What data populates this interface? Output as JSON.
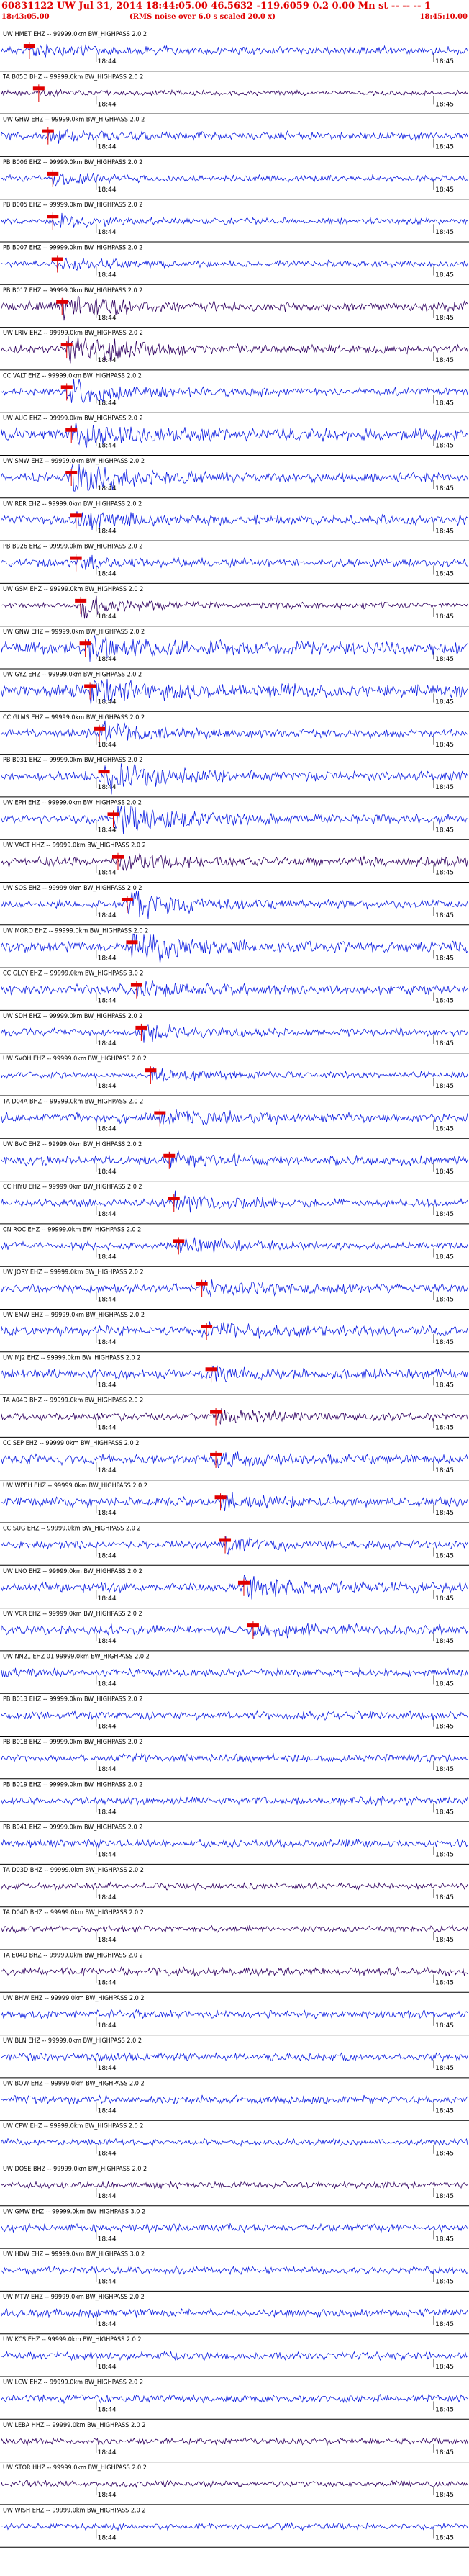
{
  "header": {
    "line1": "60831122 UW Jul 31, 2014 18:44:05.00   46.5632  -119.6059   0.2 0.00 Mn st  -- -- -- 1",
    "line2_left": "18:43:05.00",
    "line2_center": "(RMS noise over 6.0 s scaled 20.0 x)",
    "line2_right": "18:45:10.00"
  },
  "colors": {
    "trace": "#1020e0",
    "trace_dark": "#300060",
    "pick": "#e00000",
    "label": "#000000",
    "axis": "#000000"
  },
  "chart_data": {
    "type": "line",
    "time_labels": [
      "18:44",
      "18:45"
    ],
    "channels": [
      {
        "label": "UW HMET EHZ -- 99999.0km BW_HIGHPASS  2.0  2",
        "pick": 0.06,
        "amp": 0.5,
        "event": 0.2,
        "color": "blue"
      },
      {
        "label": "TA B05D BHZ -- 99999.0km BW_HIGHPASS  2.0  2",
        "pick": 0.08,
        "amp": 0.3,
        "event": 0.1,
        "color": "dark"
      },
      {
        "label": "UW GHW EHZ -- 99999.0km BW_HIGHPASS  2.0  2",
        "pick": 0.1,
        "amp": 0.5,
        "event": 0.2,
        "color": "blue"
      },
      {
        "label": "PB B006 EHZ -- 99999.0km BW_HIGHPASS  2.0  2",
        "pick": 0.11,
        "amp": 0.4,
        "event": 0.3,
        "color": "blue"
      },
      {
        "label": "PB B005 EHZ -- 99999.0km BW_HIGHPASS  2.0  2",
        "pick": 0.11,
        "amp": 0.4,
        "event": 0.3,
        "color": "blue"
      },
      {
        "label": "PB B007 EHZ -- 99999.0km BW_HIGHPASS  2.0  2",
        "pick": 0.12,
        "amp": 0.4,
        "event": 0.3,
        "color": "blue"
      },
      {
        "label": "PB B017 EHZ -- 99999.0km BW_HIGHPASS  2.0  2",
        "pick": 0.13,
        "amp": 0.6,
        "event": 0.6,
        "color": "dark"
      },
      {
        "label": "UW LRIV EHZ -- 99999.0km BW_HIGHPASS  2.0  2",
        "pick": 0.14,
        "amp": 0.5,
        "event": 1.0,
        "color": "dark"
      },
      {
        "label": "CC VALT EHZ -- 99999.0km BW_HIGHPASS  2.0  2",
        "pick": 0.14,
        "amp": 0.5,
        "event": 0.8,
        "color": "blue"
      },
      {
        "label": "UW AUG EHZ -- 99999.0km BW_HIGHPASS  2.0  2",
        "pick": 0.15,
        "amp": 0.8,
        "event": 0.5,
        "color": "blue"
      },
      {
        "label": "UW SMW EHZ -- 99999.0km BW_HIGHPASS  2.0  2",
        "pick": 0.15,
        "amp": 0.6,
        "event": 1.0,
        "color": "blue"
      },
      {
        "label": "UW RER EHZ -- 99999.0km BW_HIGHPASS  2.0  2",
        "pick": 0.16,
        "amp": 0.6,
        "event": 0.4,
        "color": "blue"
      },
      {
        "label": "PB B926 EHZ -- 99999.0km BW_HIGHPASS  2.0  2",
        "pick": 0.16,
        "amp": 0.5,
        "event": 0.3,
        "color": "blue"
      },
      {
        "label": "UW GSM EHZ -- 99999.0km BW_HIGHPASS  2.0  2",
        "pick": 0.17,
        "amp": 0.4,
        "event": 0.5,
        "color": "dark"
      },
      {
        "label": "UW GNW EHZ -- 99999.0km BW_HIGHPASS  2.0  2",
        "pick": 0.18,
        "amp": 0.8,
        "event": 0.6,
        "color": "blue"
      },
      {
        "label": "UW GYZ EHZ -- 99999.0km BW_HIGHPASS  2.0  2",
        "pick": 0.19,
        "amp": 0.8,
        "event": 0.6,
        "color": "blue"
      },
      {
        "label": "CC GLMS EHZ -- 99999.0km BW_HIGHPASS  2.0  2",
        "pick": 0.21,
        "amp": 0.5,
        "event": 0.6,
        "color": "blue"
      },
      {
        "label": "PB B031 EHZ -- 99999.0km BW_HIGHPASS  2.0  2",
        "pick": 0.22,
        "amp": 0.6,
        "event": 1.0,
        "color": "blue"
      },
      {
        "label": "UW EPH EHZ -- 99999.0km BW_HIGHPASS  2.0  2",
        "pick": 0.24,
        "amp": 0.6,
        "event": 1.0,
        "color": "blue"
      },
      {
        "label": "UW VACT HHZ -- 99999.0km BW_HIGHPASS  2.0  2",
        "pick": 0.25,
        "amp": 0.6,
        "event": 0.4,
        "color": "dark"
      },
      {
        "label": "UW SOS EHZ -- 99999.0km BW_HIGHPASS  2.0  2",
        "pick": 0.27,
        "amp": 0.5,
        "event": 0.8,
        "color": "blue"
      },
      {
        "label": "UW MORO EHZ -- 99999.0km BW_HIGHPASS  2.0  2",
        "pick": 0.28,
        "amp": 0.7,
        "event": 1.0,
        "color": "blue"
      },
      {
        "label": "CC GLCY EHZ -- 99999.0km BW_HIGHPASS  3.0  2",
        "pick": 0.29,
        "amp": 0.6,
        "event": 0.4,
        "color": "blue"
      },
      {
        "label": "UW SDH EHZ -- 99999.0km BW_HIGHPASS  2.0  2",
        "pick": 0.3,
        "amp": 0.5,
        "event": 0.4,
        "color": "blue"
      },
      {
        "label": "UW SVOH EHZ -- 99999.0km BW_HIGHPASS  2.0  2",
        "pick": 0.32,
        "amp": 0.4,
        "event": 0.3,
        "color": "blue"
      },
      {
        "label": "TA D04A BHZ -- 99999.0km BW_HIGHPASS  2.0  2",
        "pick": 0.34,
        "amp": 0.6,
        "event": 0.4,
        "color": "blue"
      },
      {
        "label": "UW BVC EHZ -- 99999.0km BW_HIGHPASS  2.0  2",
        "pick": 0.36,
        "amp": 0.6,
        "event": 0.4,
        "color": "blue"
      },
      {
        "label": "CC HIYU EHZ -- 99999.0km BW_HIGHPASS  2.0  2",
        "pick": 0.37,
        "amp": 0.5,
        "event": 0.5,
        "color": "blue"
      },
      {
        "label": "CN ROC EHZ -- 99999.0km BW_HIGHPASS  2.0  2",
        "pick": 0.38,
        "amp": 0.5,
        "event": 0.4,
        "color": "blue"
      },
      {
        "label": "UW JORY EHZ -- 99999.0km BW_HIGHPASS  2.0  2",
        "pick": 0.43,
        "amp": 0.6,
        "event": 0.4,
        "color": "blue"
      },
      {
        "label": "UW EMW EHZ -- 99999.0km BW_HIGHPASS  2.0  2",
        "pick": 0.44,
        "amp": 0.6,
        "event": 0.4,
        "color": "blue"
      },
      {
        "label": "UW MJ2 EHZ -- 99999.0km BW_HIGHPASS  2.0  2",
        "pick": 0.45,
        "amp": 0.6,
        "event": 0.3,
        "color": "blue"
      },
      {
        "label": "TA A04D BHZ -- 99999.0km BW_HIGHPASS  2.0  2",
        "pick": 0.46,
        "amp": 0.5,
        "event": 0.3,
        "color": "dark"
      },
      {
        "label": "CC SEP EHZ -- 99999.0km BW_HIGHPASS  2.0  2",
        "pick": 0.46,
        "amp": 0.6,
        "event": 0.3,
        "color": "blue"
      },
      {
        "label": "UW WPEH EHZ -- 99999.0km BW_HIGHPASS  2.0  2",
        "pick": 0.47,
        "amp": 0.6,
        "event": 0.3,
        "color": "blue"
      },
      {
        "label": "CC SUG EHZ -- 99999.0km BW_HIGHPASS  2.0  2",
        "pick": 0.48,
        "amp": 0.5,
        "event": 0.3,
        "color": "blue"
      },
      {
        "label": "UW LNO EHZ -- 99999.0km BW_HIGHPASS  2.0  2",
        "pick": 0.52,
        "amp": 0.6,
        "event": 0.6,
        "color": "blue"
      },
      {
        "label": "UW VCR EHZ -- 99999.0km BW_HIGHPASS  2.0  2",
        "pick": 0.54,
        "amp": 0.6,
        "event": 0.3,
        "color": "blue"
      },
      {
        "label": "UW NN21 EHZ 01 99999.0km BW_HIGHPASS  2.0  2",
        "pick": -1,
        "amp": 0.5,
        "event": 0,
        "color": "blue"
      },
      {
        "label": "PB B013 EHZ -- 99999.0km BW_HIGHPASS  2.0  2",
        "pick": -1,
        "amp": 0.5,
        "event": 0,
        "color": "blue"
      },
      {
        "label": "PB B018 EHZ -- 99999.0km BW_HIGHPASS  2.0  2",
        "pick": -1,
        "amp": 0.5,
        "event": 0,
        "color": "blue"
      },
      {
        "label": "PB B019 EHZ -- 99999.0km BW_HIGHPASS  2.0  2",
        "pick": -1,
        "amp": 0.5,
        "event": 0,
        "color": "blue"
      },
      {
        "label": "PB B941 EHZ -- 99999.0km BW_HIGHPASS  2.0  2",
        "pick": -1,
        "amp": 0.5,
        "event": 0,
        "color": "blue"
      },
      {
        "label": "TA D03D BHZ -- 99999.0km BW_HIGHPASS  2.0  2",
        "pick": -1,
        "amp": 0.4,
        "event": 0,
        "color": "dark"
      },
      {
        "label": "TA D04D BHZ -- 99999.0km BW_HIGHPASS  2.0  2",
        "pick": -1,
        "amp": 0.4,
        "event": 0,
        "color": "dark"
      },
      {
        "label": "TA E04D BHZ -- 99999.0km BW_HIGHPASS  2.0  2",
        "pick": -1,
        "amp": 0.5,
        "event": 0,
        "color": "dark"
      },
      {
        "label": "UW BHW EHZ -- 99999.0km BW_HIGHPASS  2.0  2",
        "pick": -1,
        "amp": 0.5,
        "event": 0,
        "color": "blue"
      },
      {
        "label": "UW BLN EHZ -- 99999.0km BW_HIGHPASS  2.0  2",
        "pick": -1,
        "amp": 0.5,
        "event": 0,
        "color": "blue"
      },
      {
        "label": "UW BOW EHZ -- 99999.0km BW_HIGHPASS  2.0  2",
        "pick": -1,
        "amp": 0.5,
        "event": 0,
        "color": "blue"
      },
      {
        "label": "UW CPW EHZ -- 99999.0km BW_HIGHPASS  2.0  2",
        "pick": -1,
        "amp": 0.4,
        "event": 0,
        "color": "blue"
      },
      {
        "label": "UW DOSE BHZ -- 99999.0km BW_HIGHPASS  2.0  2",
        "pick": -1,
        "amp": 0.4,
        "event": 0,
        "color": "dark"
      },
      {
        "label": "UW GMW EHZ -- 99999.0km BW_HIGHPASS  3.0  2",
        "pick": -1,
        "amp": 0.5,
        "event": 0,
        "color": "blue"
      },
      {
        "label": "UW HDW EHZ -- 99999.0km BW_HIGHPASS  3.0  2",
        "pick": -1,
        "amp": 0.5,
        "event": 0,
        "color": "blue"
      },
      {
        "label": "UW MTW EHZ -- 99999.0km BW_HIGHPASS  2.0  2",
        "pick": -1,
        "amp": 0.5,
        "event": 0,
        "color": "blue"
      },
      {
        "label": "UW KCS EHZ -- 99999.0km BW_HIGHPASS  2.0  2",
        "pick": -1,
        "amp": 0.5,
        "event": 0,
        "color": "blue"
      },
      {
        "label": "UW LCW EHZ -- 99999.0km BW_HIGHPASS  2.0  2",
        "pick": -1,
        "amp": 0.5,
        "event": 0,
        "color": "blue"
      },
      {
        "label": "UW LEBA HHZ -- 99999.0km BW_HIGHPASS  2.0  2",
        "pick": -1,
        "amp": 0.4,
        "event": 0,
        "color": "dark"
      },
      {
        "label": "UW STOR HHZ -- 99999.0km BW_HIGHPASS  2.0  2",
        "pick": -1,
        "amp": 0.4,
        "event": 0,
        "color": "dark"
      },
      {
        "label": "UW WISH EHZ -- 99999.0km BW_HIGHPASS  2.0  2",
        "pick": -1,
        "amp": 0.4,
        "event": 0,
        "color": "blue"
      }
    ]
  }
}
